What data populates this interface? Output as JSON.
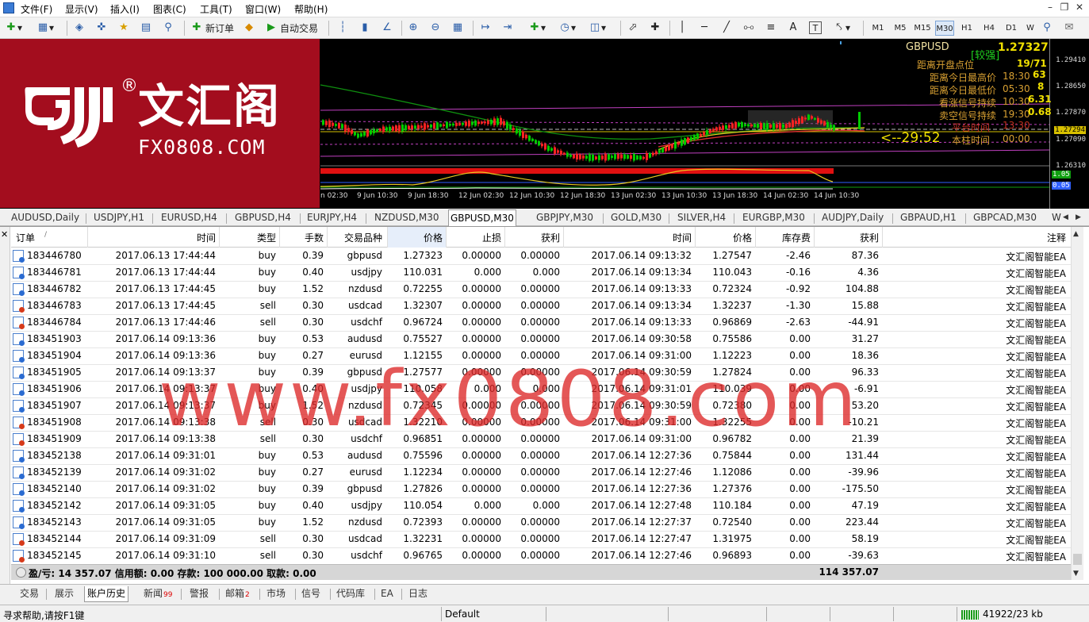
{
  "menu": {
    "items": [
      "文件(F)",
      "显示(V)",
      "插入(I)",
      "图表(C)",
      "工具(T)",
      "窗口(W)",
      "帮助(H)"
    ]
  },
  "toolbar": {
    "new_order": "新订单",
    "auto_trade": "自动交易",
    "timeframes": [
      "M1",
      "M5",
      "M15",
      "M30",
      "H1",
      "H4",
      "D1",
      "W"
    ],
    "active_timeframe": "M30"
  },
  "chart": {
    "symbol": "GBPUSD",
    "strength": "[较强]",
    "bid": "1.27327",
    "price_axis": [
      "1.29410",
      "1.28650",
      "1.27870",
      "1.27294",
      "1.27090",
      "1.26310",
      "1.05",
      "0.05"
    ],
    "time_axis": [
      "n 02:30",
      "9 Jun 10:30",
      "9 Jun 18:30",
      "12 Jun 02:30",
      "12 Jun 10:30",
      "12 Jun 18:30",
      "13 Jun 02:30",
      "13 Jun 10:30",
      "13 Jun 18:30",
      "14 Jun 02:30",
      "14 Jun 10:30"
    ],
    "info_lines": [
      {
        "label": "距离开盘点位",
        "value": "19/71"
      },
      {
        "label": "距离今日最高价",
        "time": "18:30",
        "value": "63"
      },
      {
        "label": "距离今日最低价",
        "time": "05:30",
        "value": "8"
      },
      {
        "label": "看涨信号持续",
        "time": "10:30",
        "value": "6.31"
      },
      {
        "label": "卖空信号持续",
        "time": "19:30",
        "value": "0.68"
      },
      {
        "label": "平台时间",
        "time": "13:30",
        "value": ""
      },
      {
        "label": "本柱时间",
        "time": "00:00",
        "value": ""
      }
    ],
    "countdown": "<--29:52"
  },
  "logo": {
    "cn": "文汇阁",
    "en": "FX0808.COM",
    "reg": "®"
  },
  "chart_tabs": [
    "AUDUSD,Daily",
    "USDJPY,H1",
    "EURUSD,H4",
    "GBPUSD,H4",
    "EURJPY,H4",
    "NZDUSD,M30",
    "GBPUSD,M30",
    "GBPJPY,M30",
    "GOLD,M30",
    "SILVER,H4",
    "EURGBP,M30",
    "AUDJPY,Daily",
    "GBPAUD,H1",
    "GBPCAD,M30",
    "W"
  ],
  "active_chart_tab": "GBPUSD,M30",
  "terminal": {
    "columns": [
      "订单",
      "/",
      "时间",
      "类型",
      "手数",
      "交易品种",
      "价格",
      "止损",
      "获利",
      "时间",
      "价格",
      "库存费",
      "获利",
      "注释"
    ],
    "rows": [
      [
        "183446780",
        "2017.06.13 17:44:44",
        "buy",
        "0.39",
        "gbpusd",
        "1.27323",
        "0.00000",
        "0.00000",
        "2017.06.14 09:13:32",
        "1.27547",
        "-2.46",
        "87.36",
        "文汇阁智能EA"
      ],
      [
        "183446781",
        "2017.06.13 17:44:44",
        "buy",
        "0.40",
        "usdjpy",
        "110.031",
        "0.000",
        "0.000",
        "2017.06.14 09:13:34",
        "110.043",
        "-0.16",
        "4.36",
        "文汇阁智能EA"
      ],
      [
        "183446782",
        "2017.06.13 17:44:45",
        "buy",
        "1.52",
        "nzdusd",
        "0.72255",
        "0.00000",
        "0.00000",
        "2017.06.14 09:13:33",
        "0.72324",
        "-0.92",
        "104.88",
        "文汇阁智能EA"
      ],
      [
        "183446783",
        "2017.06.13 17:44:45",
        "sell",
        "0.30",
        "usdcad",
        "1.32307",
        "0.00000",
        "0.00000",
        "2017.06.14 09:13:34",
        "1.32237",
        "-1.30",
        "15.88",
        "文汇阁智能EA"
      ],
      [
        "183446784",
        "2017.06.13 17:44:46",
        "sell",
        "0.30",
        "usdchf",
        "0.96724",
        "0.00000",
        "0.00000",
        "2017.06.14 09:13:33",
        "0.96869",
        "-2.63",
        "-44.91",
        "文汇阁智能EA"
      ],
      [
        "183451903",
        "2017.06.14 09:13:36",
        "buy",
        "0.53",
        "audusd",
        "0.75527",
        "0.00000",
        "0.00000",
        "2017.06.14 09:30:58",
        "0.75586",
        "0.00",
        "31.27",
        "文汇阁智能EA"
      ],
      [
        "183451904",
        "2017.06.14 09:13:36",
        "buy",
        "0.27",
        "eurusd",
        "1.12155",
        "0.00000",
        "0.00000",
        "2017.06.14 09:31:00",
        "1.12223",
        "0.00",
        "18.36",
        "文汇阁智能EA"
      ],
      [
        "183451905",
        "2017.06.14 09:13:37",
        "buy",
        "0.39",
        "gbpusd",
        "1.27577",
        "0.00000",
        "0.00000",
        "2017.06.14 09:30:59",
        "1.27824",
        "0.00",
        "96.33",
        "文汇阁智能EA"
      ],
      [
        "183451906",
        "2017.06.14 09:13:37",
        "buy",
        "0.40",
        "usdjpy",
        "110.058",
        "0.000",
        "0.000",
        "2017.06.14 09:31:01",
        "110.039",
        "0.00",
        "-6.91",
        "文汇阁智能EA"
      ],
      [
        "183451907",
        "2017.06.14 09:13:37",
        "buy",
        "1.52",
        "nzdusd",
        "0.72345",
        "0.00000",
        "0.00000",
        "2017.06.14 09:30:59",
        "0.72380",
        "0.00",
        "53.20",
        "文汇阁智能EA"
      ],
      [
        "183451908",
        "2017.06.14 09:13:38",
        "sell",
        "0.30",
        "usdcad",
        "1.32210",
        "0.00000",
        "0.00000",
        "2017.06.14 09:31:00",
        "1.32255",
        "0.00",
        "-10.21",
        "文汇阁智能EA"
      ],
      [
        "183451909",
        "2017.06.14 09:13:38",
        "sell",
        "0.30",
        "usdchf",
        "0.96851",
        "0.00000",
        "0.00000",
        "2017.06.14 09:31:00",
        "0.96782",
        "0.00",
        "21.39",
        "文汇阁智能EA"
      ],
      [
        "183452138",
        "2017.06.14 09:31:01",
        "buy",
        "0.53",
        "audusd",
        "0.75596",
        "0.00000",
        "0.00000",
        "2017.06.14 12:27:36",
        "0.75844",
        "0.00",
        "131.44",
        "文汇阁智能EA"
      ],
      [
        "183452139",
        "2017.06.14 09:31:02",
        "buy",
        "0.27",
        "eurusd",
        "1.12234",
        "0.00000",
        "0.00000",
        "2017.06.14 12:27:46",
        "1.12086",
        "0.00",
        "-39.96",
        "文汇阁智能EA"
      ],
      [
        "183452140",
        "2017.06.14 09:31:02",
        "buy",
        "0.39",
        "gbpusd",
        "1.27826",
        "0.00000",
        "0.00000",
        "2017.06.14 12:27:36",
        "1.27376",
        "0.00",
        "-175.50",
        "文汇阁智能EA"
      ],
      [
        "183452142",
        "2017.06.14 09:31:05",
        "buy",
        "0.40",
        "usdjpy",
        "110.054",
        "0.000",
        "0.000",
        "2017.06.14 12:27:48",
        "110.184",
        "0.00",
        "47.19",
        "文汇阁智能EA"
      ],
      [
        "183452143",
        "2017.06.14 09:31:05",
        "buy",
        "1.52",
        "nzdusd",
        "0.72393",
        "0.00000",
        "0.00000",
        "2017.06.14 12:27:37",
        "0.72540",
        "0.00",
        "223.44",
        "文汇阁智能EA"
      ],
      [
        "183452144",
        "2017.06.14 09:31:09",
        "sell",
        "0.30",
        "usdcad",
        "1.32231",
        "0.00000",
        "0.00000",
        "2017.06.14 12:27:47",
        "1.31975",
        "0.00",
        "58.19",
        "文汇阁智能EA"
      ],
      [
        "183452145",
        "2017.06.14 09:31:10",
        "sell",
        "0.30",
        "usdchf",
        "0.96765",
        "0.00000",
        "0.00000",
        "2017.06.14 12:27:46",
        "0.96893",
        "0.00",
        "-39.63",
        "文汇阁智能EA"
      ]
    ],
    "summary": "盈/亏: 14 357.07  信用额: 0.00  存款: 100 000.00  取款: 0.00",
    "summary_total": "114 357.07"
  },
  "bottom_tabs": [
    {
      "label": "交易",
      "badge": ""
    },
    {
      "label": "展示",
      "badge": ""
    },
    {
      "label": "账户历史",
      "badge": ""
    },
    {
      "label": "新闻",
      "badge": "99"
    },
    {
      "label": "警报",
      "badge": ""
    },
    {
      "label": "邮箱",
      "badge": "2"
    },
    {
      "label": "市场",
      "badge": ""
    },
    {
      "label": "信号",
      "badge": ""
    },
    {
      "label": "代码库",
      "badge": ""
    },
    {
      "label": "EA",
      "badge": ""
    },
    {
      "label": "日志",
      "badge": ""
    }
  ],
  "active_bottom_tab": "账户历史",
  "status": {
    "left": "寻求帮助,请按F1键",
    "profile": "Default",
    "traffic": "41922/23 kb"
  },
  "watermark": "www.fx0808.com",
  "colors": {
    "logo_bg": "#a30d1e",
    "watermark": "#dc2828",
    "chart_bg": "#000000",
    "bull": "#00cc00",
    "bear": "#ff2222",
    "info_text": "#d8a032"
  }
}
